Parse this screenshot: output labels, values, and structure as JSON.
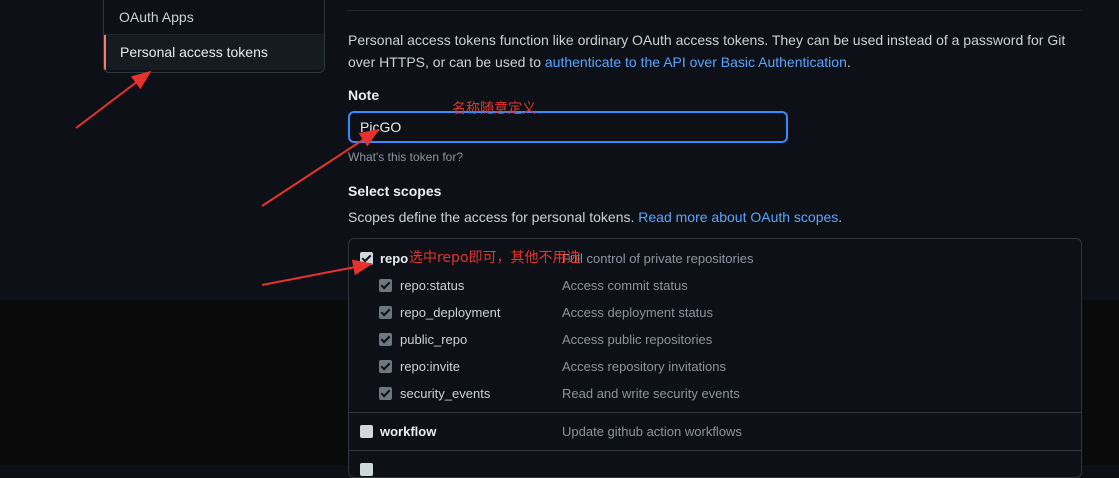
{
  "sidebar": {
    "items": [
      {
        "label": "OAuth Apps"
      },
      {
        "label": "Personal access tokens"
      }
    ]
  },
  "intro": {
    "text": "Personal access tokens function like ordinary OAuth access tokens. They can be used instead of a password for Git over HTTPS, or can be used to ",
    "link": "authenticate to the API over Basic Authentication",
    "suffix": "."
  },
  "note": {
    "label": "Note",
    "value": "PicGO",
    "hint": "What's this token for?"
  },
  "scopes": {
    "label": "Select scopes",
    "desc": "Scopes define the access for personal tokens. ",
    "desc_link": "Read more about OAuth scopes",
    "desc_suffix": ".",
    "items": [
      {
        "name": "repo",
        "desc": "Full control of private repositories",
        "checked": true
      },
      {
        "name": "repo:status",
        "desc": "Access commit status",
        "checked": true
      },
      {
        "name": "repo_deployment",
        "desc": "Access deployment status",
        "checked": true
      },
      {
        "name": "public_repo",
        "desc": "Access public repositories",
        "checked": true
      },
      {
        "name": "repo:invite",
        "desc": "Access repository invitations",
        "checked": true
      },
      {
        "name": "security_events",
        "desc": "Read and write security events",
        "checked": true
      },
      {
        "name": "workflow",
        "desc": "Update github action workflows",
        "checked": false
      }
    ]
  },
  "annotations": {
    "note_hint": "名称随意定义",
    "repo_hint": "选中repo即可，其他不用选",
    "color": "#e5322d"
  }
}
